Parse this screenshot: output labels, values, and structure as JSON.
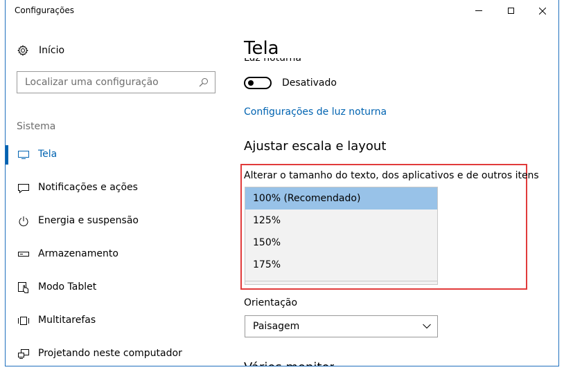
{
  "window": {
    "title": "Configurações"
  },
  "sidebar": {
    "home_label": "Início",
    "search_placeholder": "Localizar uma configuração",
    "section_label": "Sistema",
    "items": [
      {
        "label": "Tela",
        "icon": "monitor-icon",
        "selected": true
      },
      {
        "label": "Notificações e ações",
        "icon": "notification-icon"
      },
      {
        "label": "Energia e suspensão",
        "icon": "power-icon"
      },
      {
        "label": "Armazenamento",
        "icon": "storage-icon"
      },
      {
        "label": "Modo Tablet",
        "icon": "tablet-icon"
      },
      {
        "label": "Multitarefas",
        "icon": "multitask-icon"
      },
      {
        "label": "Projetando neste computador",
        "icon": "projecting-icon"
      }
    ]
  },
  "main": {
    "title": "Tela",
    "night_light_label": "Luz noturna",
    "night_light_state": "Desativado",
    "night_light_link": "Configurações de luz noturna",
    "scale_heading": "Ajustar escala e layout",
    "scale_label": "Alterar o tamanho do texto, dos aplicativos e de outros itens",
    "scale_options": [
      "100% (Recomendado)",
      "125%",
      "150%",
      "175%"
    ],
    "scale_selected_index": 0,
    "orientation_label": "Orientação",
    "orientation_value": "Paisagem",
    "next_heading": "Vários monitores"
  },
  "colors": {
    "accent": "#0063b1",
    "highlight": "#98c2e8",
    "red_box": "#e13a3a"
  }
}
